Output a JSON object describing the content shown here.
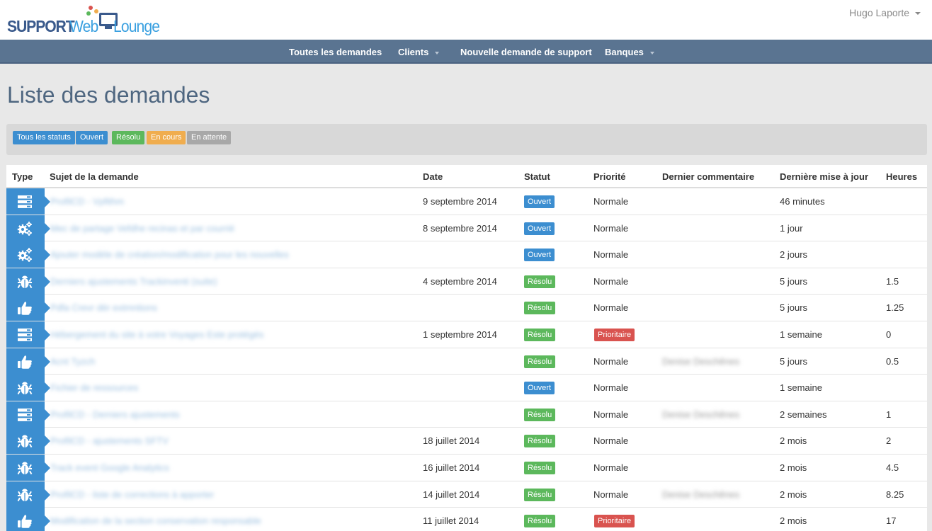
{
  "app": {
    "logo_support": "SUPPORT",
    "logo_web": "Web",
    "logo_lounge": "Lounge",
    "user_name": "Hugo Laporte"
  },
  "nav": {
    "items": [
      {
        "label": "Toutes les demandes",
        "has_caret": false
      },
      {
        "label": "Clients",
        "has_caret": true
      },
      {
        "label": "Nouvelle demande de support",
        "has_caret": false
      },
      {
        "label": "Banques",
        "has_caret": true
      }
    ]
  },
  "page_title": "Liste des demandes",
  "filters": [
    {
      "label": "Tous les statuts",
      "color": "#3c8ed0"
    },
    {
      "label": "Ouvert",
      "color": "#3c8ed0"
    },
    {
      "label": "Résolu",
      "color": "#5cb85c"
    },
    {
      "label": "En cours",
      "color": "#f0ad4e"
    },
    {
      "label": "En attente",
      "color": "#999999"
    }
  ],
  "table": {
    "headers": [
      "Type",
      "Sujet de la demande",
      "Date",
      "Statut",
      "Priorité",
      "Dernier commentaire",
      "Dernière mise à jour",
      "Heures"
    ],
    "rows": [
      {
        "type": "server",
        "subject": "ProfilCD - Vpfithm",
        "date": "9 septembre 2014",
        "status": "Ouvert",
        "priority": "Normale",
        "comment": "",
        "updated": "46 minutes",
        "hours": ""
      },
      {
        "type": "gears",
        "subject": "Mec de partage Vefdhe recinas et par courrié",
        "date": "8 septembre 2014",
        "status": "Ouvert",
        "priority": "Normale",
        "comment": "",
        "updated": "1 jour",
        "hours": ""
      },
      {
        "type": "gears",
        "subject": "Ajouter modèle de création/modification pour les nouvelles",
        "date": "",
        "status": "Ouvert",
        "priority": "Normale",
        "comment": "",
        "updated": "2 jours",
        "hours": ""
      },
      {
        "type": "bug",
        "subject": "Derniers ajustements Trackinventi (suite)",
        "date": "4 septembre 2014",
        "status": "Résolu",
        "priority": "Normale",
        "comment": "",
        "updated": "5 jours",
        "hours": "1.5"
      },
      {
        "type": "thumb",
        "subject": "Pdfa Crevr dèr extmntions",
        "date": "",
        "status": "Résolu",
        "priority": "Normale",
        "comment": "",
        "updated": "5 jours",
        "hours": "1.25"
      },
      {
        "type": "server",
        "subject": "Hébergement du site à votre Voyages Este protégés",
        "date": "1 septembre 2014",
        "status": "Résolu",
        "priority": "Prioritaire",
        "comment": "",
        "updated": "1 semaine",
        "hours": "0"
      },
      {
        "type": "thumb",
        "subject": "Acnt Tyzch",
        "date": "",
        "status": "Résolu",
        "priority": "Normale",
        "comment": "Denise Deschênes",
        "updated": "5 jours",
        "hours": "0.5"
      },
      {
        "type": "bug",
        "subject": "Fichier de ressources",
        "date": "",
        "status": "Ouvert",
        "priority": "Normale",
        "comment": "",
        "updated": "1 semaine",
        "hours": ""
      },
      {
        "type": "server",
        "subject": "ProfilCD - Derniers ajustements",
        "date": "",
        "status": "Résolu",
        "priority": "Normale",
        "comment": "Denise Deschênes",
        "updated": "2 semaines",
        "hours": "1"
      },
      {
        "type": "bug",
        "subject": "ProfilCD - ajustements SFTV",
        "date": "18 juillet 2014",
        "status": "Résolu",
        "priority": "Normale",
        "comment": "",
        "updated": "2 mois",
        "hours": "2"
      },
      {
        "type": "bug",
        "subject": "Track event Google Analytics",
        "date": "16 juillet 2014",
        "status": "Résolu",
        "priority": "Normale",
        "comment": "",
        "updated": "2 mois",
        "hours": "4.5"
      },
      {
        "type": "bug",
        "subject": "ProfilCD - liste de corrections à apporter",
        "date": "14 juillet 2014",
        "status": "Résolu",
        "priority": "Normale",
        "comment": "Denise Deschênes",
        "updated": "2 mois",
        "hours": "8.25"
      },
      {
        "type": "thumb",
        "subject": "Modification de la section conservation responsable",
        "date": "11 juillet 2014",
        "status": "Résolu",
        "priority": "Prioritaire",
        "comment": "",
        "updated": "2 mois",
        "hours": "17"
      }
    ]
  },
  "colors": {
    "open": "#3c8ed0",
    "resolved": "#5cb85c",
    "priority_high": "#d9534f",
    "navbar": "#5a7491"
  }
}
